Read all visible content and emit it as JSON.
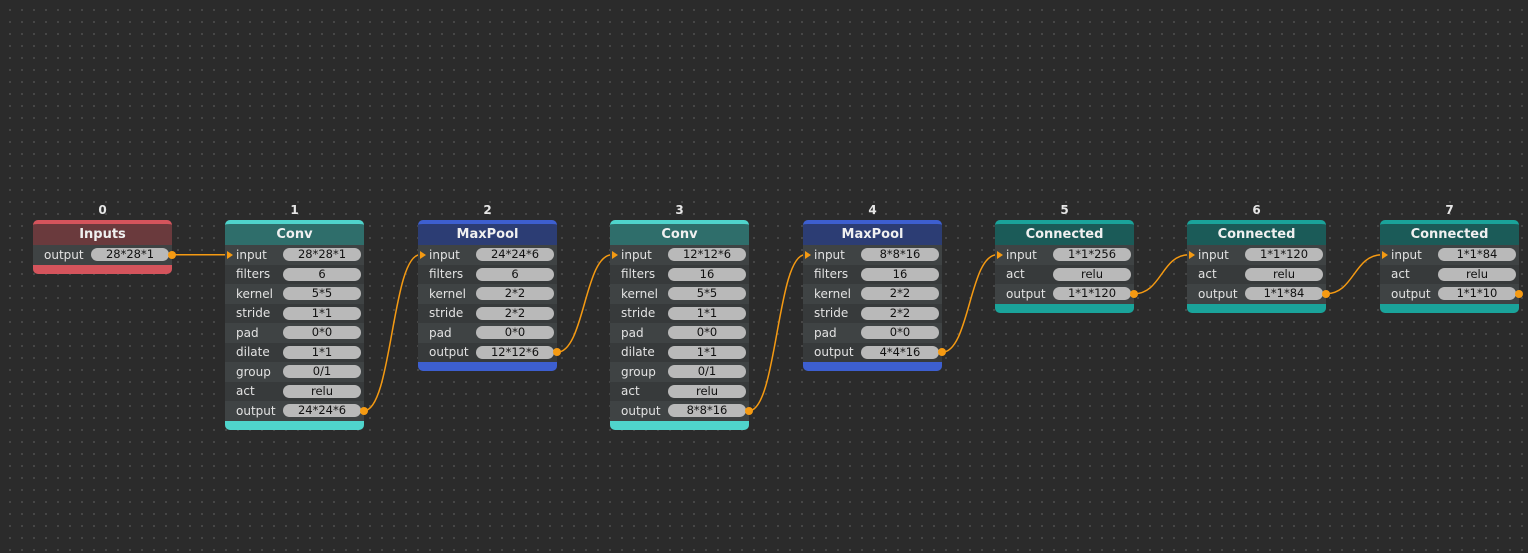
{
  "colors": {
    "background": "#2b2b2b",
    "wire": "#f59a12",
    "inputs": "#d4545c",
    "conv": "#4fd4cc",
    "maxpool": "#3d5fd0",
    "connected": "#1aa39a"
  },
  "nodes": [
    {
      "index": "0",
      "title": "Inputs",
      "type": "inputs",
      "rows": [
        {
          "label": "output",
          "value": "28*28*1",
          "port": "out"
        }
      ]
    },
    {
      "index": "1",
      "title": "Conv",
      "type": "conv",
      "rows": [
        {
          "label": "input",
          "value": "28*28*1",
          "port": "in"
        },
        {
          "label": "filters",
          "value": "6"
        },
        {
          "label": "kernel",
          "value": "5*5"
        },
        {
          "label": "stride",
          "value": "1*1"
        },
        {
          "label": "pad",
          "value": "0*0"
        },
        {
          "label": "dilate",
          "value": "1*1"
        },
        {
          "label": "group",
          "value": "0/1"
        },
        {
          "label": "act",
          "value": "relu"
        },
        {
          "label": "output",
          "value": "24*24*6",
          "port": "out"
        }
      ]
    },
    {
      "index": "2",
      "title": "MaxPool",
      "type": "maxpool",
      "rows": [
        {
          "label": "input",
          "value": "24*24*6",
          "port": "in"
        },
        {
          "label": "filters",
          "value": "6"
        },
        {
          "label": "kernel",
          "value": "2*2"
        },
        {
          "label": "stride",
          "value": "2*2"
        },
        {
          "label": "pad",
          "value": "0*0"
        },
        {
          "label": "output",
          "value": "12*12*6",
          "port": "out"
        }
      ]
    },
    {
      "index": "3",
      "title": "Conv",
      "type": "conv",
      "rows": [
        {
          "label": "input",
          "value": "12*12*6",
          "port": "in"
        },
        {
          "label": "filters",
          "value": "16"
        },
        {
          "label": "kernel",
          "value": "5*5"
        },
        {
          "label": "stride",
          "value": "1*1"
        },
        {
          "label": "pad",
          "value": "0*0"
        },
        {
          "label": "dilate",
          "value": "1*1"
        },
        {
          "label": "group",
          "value": "0/1"
        },
        {
          "label": "act",
          "value": "relu"
        },
        {
          "label": "output",
          "value": "8*8*16",
          "port": "out"
        }
      ]
    },
    {
      "index": "4",
      "title": "MaxPool",
      "type": "maxpool",
      "rows": [
        {
          "label": "input",
          "value": "8*8*16",
          "port": "in"
        },
        {
          "label": "filters",
          "value": "16"
        },
        {
          "label": "kernel",
          "value": "2*2"
        },
        {
          "label": "stride",
          "value": "2*2"
        },
        {
          "label": "pad",
          "value": "0*0"
        },
        {
          "label": "output",
          "value": "4*4*16",
          "port": "out"
        }
      ]
    },
    {
      "index": "5",
      "title": "Connected",
      "type": "connected",
      "rows": [
        {
          "label": "input",
          "value": "1*1*256",
          "port": "in"
        },
        {
          "label": "act",
          "value": "relu"
        },
        {
          "label": "output",
          "value": "1*1*120",
          "port": "out"
        }
      ]
    },
    {
      "index": "6",
      "title": "Connected",
      "type": "connected",
      "rows": [
        {
          "label": "input",
          "value": "1*1*120",
          "port": "in"
        },
        {
          "label": "act",
          "value": "relu"
        },
        {
          "label": "output",
          "value": "1*1*84",
          "port": "out"
        }
      ]
    },
    {
      "index": "7",
      "title": "Connected",
      "type": "connected",
      "rows": [
        {
          "label": "input",
          "value": "1*1*84",
          "port": "in"
        },
        {
          "label": "act",
          "value": "relu"
        },
        {
          "label": "output",
          "value": "1*1*10",
          "port": "out"
        }
      ]
    }
  ]
}
